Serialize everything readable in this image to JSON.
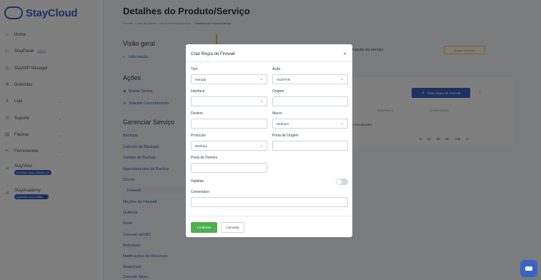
{
  "brand": {
    "name": "StayCloud"
  },
  "sidebar": {
    "items": [
      {
        "label": "Home",
        "icon": "home-icon"
      },
      {
        "label": "StayPanel",
        "badge": "Beta",
        "icon": "panel-icon"
      },
      {
        "label": "StayWP Manager",
        "icon": "wordpress-icon"
      },
      {
        "label": "Domínios",
        "icon": "globe-icon"
      },
      {
        "label": "Loja",
        "icon": "cart-icon"
      },
      {
        "label": "Suporte",
        "icon": "support-icon"
      },
      {
        "label": "Faturas",
        "icon": "invoice-icon"
      },
      {
        "label": "Ferramentas",
        "icon": "tools-icon"
      },
      {
        "label": "StayView",
        "pill": "Monitore seus clientes 🔗",
        "icon": "chart-icon"
      },
      {
        "label": "StayAcademy",
        "pill": "Aprenda com a Stay 🎓",
        "icon": "academy-icon"
      }
    ]
  },
  "page": {
    "title": "Detalhes do Produto/Serviço",
    "breadcrumb": [
      "Suporte",
      "Área do Cliente",
      "Meus Produtos/Serviços",
      "Detalhes do Produto/Serviço"
    ]
  },
  "overview": {
    "heading": "Visão geral",
    "info_link": "Informação",
    "actions_heading": "Ações",
    "actions": [
      "Mudar Senha",
      "Solicitar Cancelamento"
    ],
    "manage_heading": "Gerenciar Serviço",
    "manage_items": [
      "Backups",
      "Coleção de Backups",
      "Tarefas de Backup",
      "Agendamentos de Backup",
      "Discos",
      "Firewall",
      "Opções do Firewall",
      "Gráficos",
      "Rede",
      "Console noVNC",
      "Reinstalar",
      "Notificações de Recursos",
      "Snapshots",
      "Console Spice"
    ]
  },
  "background": {
    "info_text": "erupção do serviço.",
    "info_button": "Regras (Ver em)",
    "create_button": "Criar Regra de Firewall",
    "columns": [
      "INTERVALO",
      "COMENTÁRIO"
    ],
    "empty_text": "os encontrados",
    "pager": [
      "5",
      "10",
      "20",
      "50",
      "100",
      "∞"
    ]
  },
  "modal": {
    "title": "Criar Regra de Firewall",
    "fields": {
      "tipo": {
        "label": "Tipo",
        "value": "entrada"
      },
      "acao": {
        "label": "Ação",
        "value": "ACEITAR"
      },
      "interface": {
        "label": "Interface",
        "value": ""
      },
      "origem": {
        "label": "Origem",
        "value": ""
      },
      "destino": {
        "label": "Destino",
        "value": ""
      },
      "macro": {
        "label": "Macro",
        "value": "Nenhum"
      },
      "protocolo": {
        "label": "Protocolo",
        "value": "Nenhum"
      },
      "porta_origem": {
        "label": "Porta de Origem",
        "value": ""
      },
      "porta_destino": {
        "label": "Porta de Destino",
        "value": ""
      },
      "habilitar": {
        "label": "Habilitar",
        "enabled": false
      },
      "comentario": {
        "label": "Comentário",
        "value": ""
      }
    },
    "confirm": "Confirmar",
    "cancel": "Cancelar"
  },
  "colors": {
    "brand": "#3a63c4",
    "confirm": "#4caf50",
    "warning": "#e9b949"
  }
}
